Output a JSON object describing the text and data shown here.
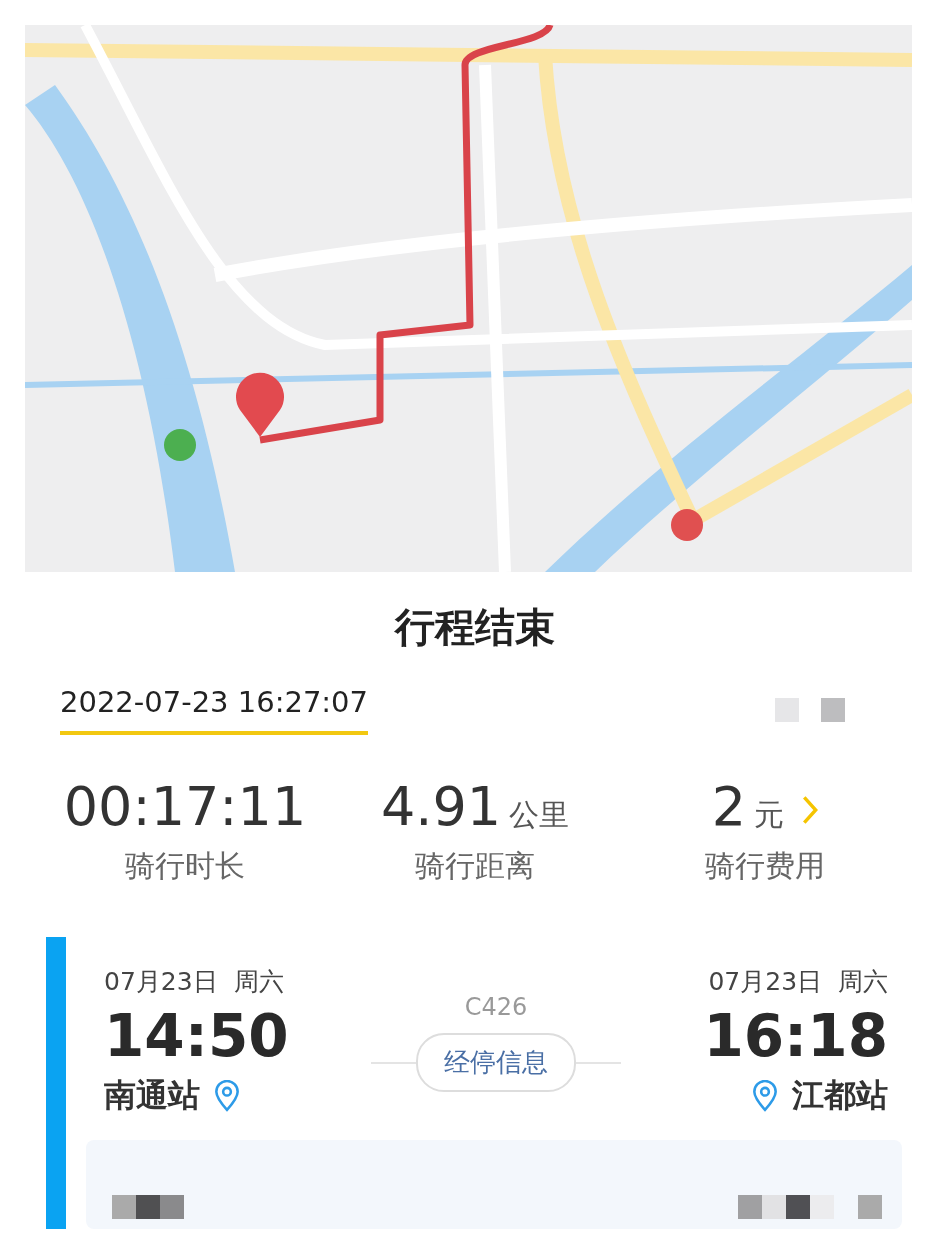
{
  "title": "行程结束",
  "tabs": [
    {
      "label": "2022-07-23 16:27:07",
      "selected": true
    }
  ],
  "stats": [
    {
      "value": "00:17:11",
      "label": "骑行时长",
      "link": false
    },
    {
      "value": "4.91",
      "unit": "公里",
      "label": "骑行距离",
      "link": false
    },
    {
      "value": "2",
      "unit": "元",
      "label": "骑行费用",
      "link": true
    }
  ],
  "ticket": {
    "train": "C426",
    "stops_button": "经停信息",
    "departure": {
      "date": "07月23日",
      "weekday": "周六",
      "time": "14:50",
      "station": "南通站"
    },
    "arrival": {
      "date": "07月23日",
      "weekday": "周六",
      "time": "16:18",
      "station": "江都站"
    }
  }
}
